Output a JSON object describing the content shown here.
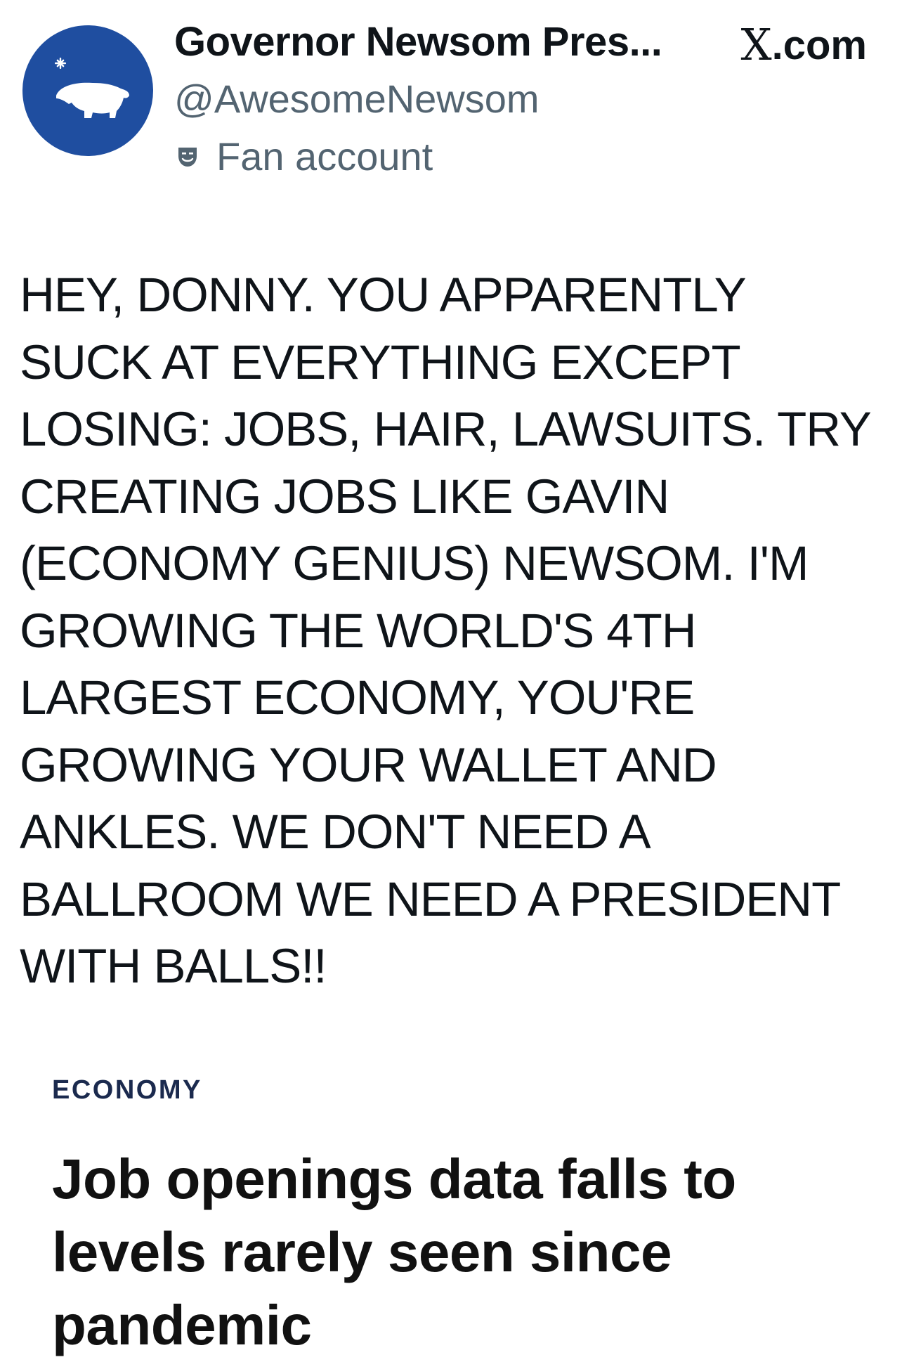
{
  "post": {
    "display_name": "Governor Newsom Pres...",
    "source": ".com",
    "source_logo": "X",
    "handle": "@AwesomeNewsom",
    "account_label": "Fan account",
    "account_label_icon": "theater-mask-icon",
    "avatar_icon": "bear-flag-icon",
    "text_lines": [
      "HEY, DONNY. YOU APPARENTLY",
      "SUCK AT EVERYTHING EXCEPT",
      "LOSING: JOBS, HAIR, LAWSUITS. TRY",
      "CREATING JOBS LIKE GAVIN",
      "(ECONOMY GENIUS) NEWSOM. I'M",
      "GROWING THE WORLD'S 4TH",
      "LARGEST ECONOMY, YOU'RE",
      "GROWING YOUR WALLET AND",
      "ANKLES. WE DON'T NEED A",
      "BALLROOM WE NEED A PRESIDENT",
      "WITH BALLS!!"
    ]
  },
  "article": {
    "category": "ECONOMY",
    "headline_lines": [
      "Job openings data falls to",
      "levels rarely seen since",
      "pandemic"
    ]
  },
  "colors": {
    "avatar_bg": "#1f4ea0",
    "secondary_text": "#536471",
    "category": "#1b2a4e"
  }
}
